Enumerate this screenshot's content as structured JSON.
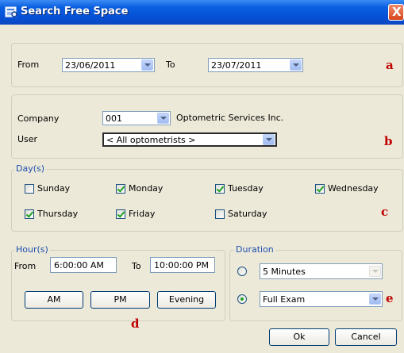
{
  "window": {
    "title": "Search Free Space",
    "close_label": "X"
  },
  "date_range": {
    "from_label": "From",
    "from_value": "23/06/2011",
    "to_label": "To",
    "to_value": "23/07/2011",
    "marker": "a"
  },
  "company_section": {
    "company_label": "Company",
    "company_value": "001",
    "company_name": "Optometric Services Inc.",
    "user_label": "User",
    "user_value": "< All optometrists >",
    "marker": "b"
  },
  "days": {
    "legend": "Day(s)",
    "items": [
      {
        "label": "Sunday",
        "checked": false
      },
      {
        "label": "Monday",
        "checked": true
      },
      {
        "label": "Tuesday",
        "checked": true
      },
      {
        "label": "Wednesday",
        "checked": true
      },
      {
        "label": "Thursday",
        "checked": true
      },
      {
        "label": "Friday",
        "checked": true
      },
      {
        "label": "Saturday",
        "checked": false
      }
    ],
    "marker": "c"
  },
  "hours": {
    "legend": "Hour(s)",
    "from_label": "From",
    "from_value": "6:00:00 AM",
    "to_label": "To",
    "to_value": "10:00:00 PM",
    "am_label": "AM",
    "pm_label": "PM",
    "evening_label": "Evening",
    "marker": "d"
  },
  "duration": {
    "legend": "Duration",
    "option1_value": "5 Minutes",
    "option1_selected": false,
    "option2_value": "Full Exam",
    "option2_selected": true,
    "marker": "e"
  },
  "footer": {
    "ok_label": "Ok",
    "cancel_label": "Cancel"
  }
}
